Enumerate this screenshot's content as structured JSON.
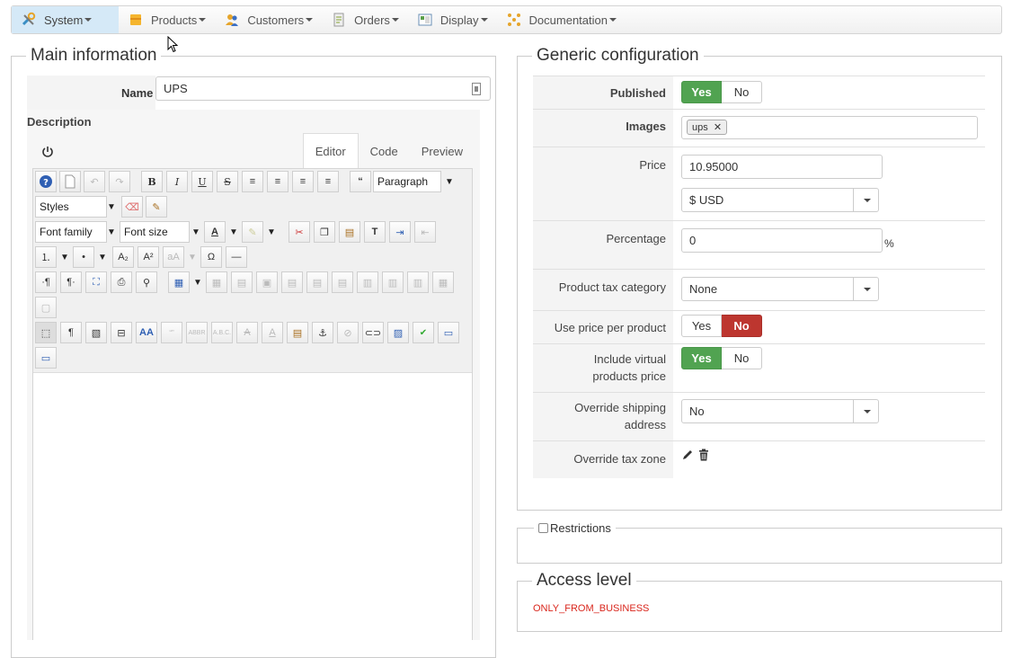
{
  "nav": {
    "items": [
      {
        "label": "System",
        "icon": "wrench-icon"
      },
      {
        "label": "Products",
        "icon": "box-icon"
      },
      {
        "label": "Customers",
        "icon": "users-icon"
      },
      {
        "label": "Orders",
        "icon": "orders-icon"
      },
      {
        "label": "Display",
        "icon": "display-icon"
      },
      {
        "label": "Documentation",
        "icon": "docs-icon"
      }
    ]
  },
  "main": {
    "legend": "Main information",
    "name_label": "Name",
    "name_value": "UPS",
    "description_label": "Description",
    "editor": {
      "tabs": [
        "Editor",
        "Code",
        "Preview"
      ],
      "format_select": "Paragraph",
      "styles_select": "Styles",
      "font_family_select": "Font family",
      "font_size_select": "Font size"
    }
  },
  "generic": {
    "legend": "Generic configuration",
    "published_label": "Published",
    "yes": "Yes",
    "no": "No",
    "images_label": "Images",
    "image_tag": "ups",
    "price_label": "Price",
    "price_value": "10.95000",
    "currency_value": "$ USD",
    "percentage_label": "Percentage",
    "percentage_value": "0",
    "percentage_unit": "%",
    "tax_category_label": "Product tax category",
    "tax_category_value": "None",
    "use_price_label": "Use price per product",
    "include_virtual_label_1": "Include virtual",
    "include_virtual_label_2": "products price",
    "override_shipping_label_1": "Override shipping",
    "override_shipping_label_2": "address",
    "override_shipping_value": "No",
    "override_tax_label": "Override tax zone"
  },
  "restrictions": {
    "legend": "Restrictions"
  },
  "access": {
    "legend": "Access level",
    "value": "ONLY_FROM_BUSINESS"
  },
  "colors": {
    "accent_green": "#51a351",
    "accent_red": "#bd362f",
    "access_text": "#d9261c"
  }
}
